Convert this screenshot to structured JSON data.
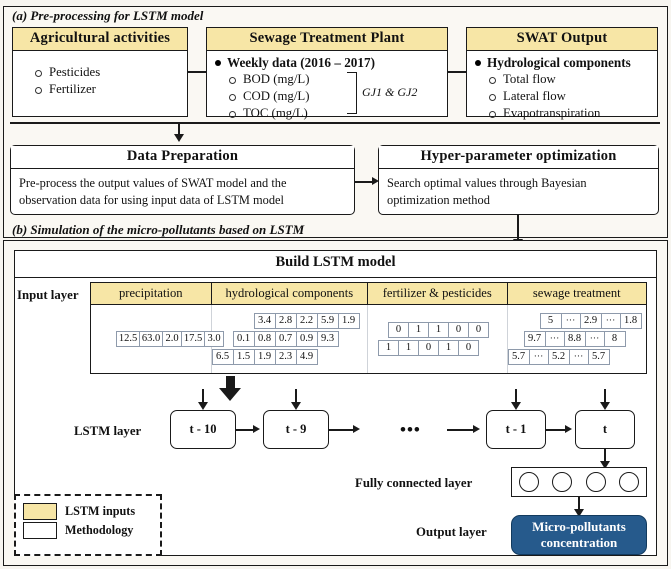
{
  "colors": {
    "header_yellow": "#f7e6a6",
    "output_blue": "#265a8c",
    "page_bg": "#f7f5f0",
    "line": "#1a1a1a"
  },
  "section_a": {
    "label": "(a) Pre-processing for LSTM model",
    "boxes": [
      {
        "title": "Agricultural activities",
        "items": [
          {
            "level": "sub",
            "text": "Pesticides"
          },
          {
            "level": "sub",
            "text": "Fertilizer"
          }
        ]
      },
      {
        "title": "Sewage Treatment Plant",
        "items": [
          {
            "level": "main",
            "text": "Weekly data (2016 – 2017)"
          },
          {
            "level": "sub",
            "text": "BOD (mg/L)"
          },
          {
            "level": "sub",
            "text": "COD (mg/L)"
          },
          {
            "level": "sub",
            "text": "TOC (mg/L)"
          }
        ],
        "annotation": "GJ1 & GJ2"
      },
      {
        "title": "SWAT Output",
        "items": [
          {
            "level": "main",
            "text": "Hydrological components"
          },
          {
            "level": "sub",
            "text": "Total flow"
          },
          {
            "level": "sub",
            "text": "Lateral flow"
          },
          {
            "level": "sub",
            "text": "Evapotranspiration"
          }
        ]
      }
    ],
    "process_boxes": [
      {
        "title": "Data Preparation",
        "body": "Pre-process the output values of SWAT model and the observation data for using input data of LSTM model"
      },
      {
        "title": "Hyper-parameter optimization",
        "body": "Search optimal values through Bayesian optimization method"
      }
    ]
  },
  "section_b": {
    "label": "(b) Simulation of the micro-pollutants based on LSTM",
    "title": "Build LSTM model",
    "input_layer_label": "Input layer",
    "lstm_layer_label": "LSTM layer",
    "fully_connected_label": "Fully connected layer",
    "output_layer_label": "Output layer",
    "input_columns": [
      {
        "header": "precipitation",
        "rows": [
          [
            "12.5",
            "63.0",
            "2.0",
            "17.5",
            "3.0"
          ]
        ]
      },
      {
        "header": "hydrological components",
        "rows": [
          [
            "3.4",
            "2.8",
            "2.2",
            "5.9",
            "1.9"
          ],
          [
            "0.1",
            "0.8",
            "0.7",
            "0.9",
            "9.3"
          ],
          [
            "6.5",
            "1.5",
            "1.9",
            "2.3",
            "4.9"
          ]
        ]
      },
      {
        "header": "fertilizer & pesticides",
        "rows": [
          [
            "0",
            "1",
            "1",
            "0",
            "0"
          ],
          [
            "1",
            "1",
            "0",
            "1",
            "0"
          ]
        ]
      },
      {
        "header": "sewage treatment",
        "rows": [
          [
            "5",
            "···",
            "2.9",
            "···",
            "1.8"
          ],
          [
            "9.7",
            "···",
            "8.8",
            "···",
            "8"
          ],
          [
            "5.7",
            "···",
            "5.2",
            "···",
            "5.7"
          ]
        ]
      }
    ],
    "lstm_cells": [
      "t - 10",
      "t - 9",
      "t - 1",
      "t"
    ],
    "lstm_ellipsis": "•••",
    "neuron_count": 4,
    "output_text_line1": "Micro-pollutants",
    "output_text_line2": "concentration"
  },
  "legend": {
    "items": [
      {
        "swatch": "yellow",
        "label": "LSTM inputs"
      },
      {
        "swatch": "white",
        "label": "Methodology"
      }
    ]
  }
}
